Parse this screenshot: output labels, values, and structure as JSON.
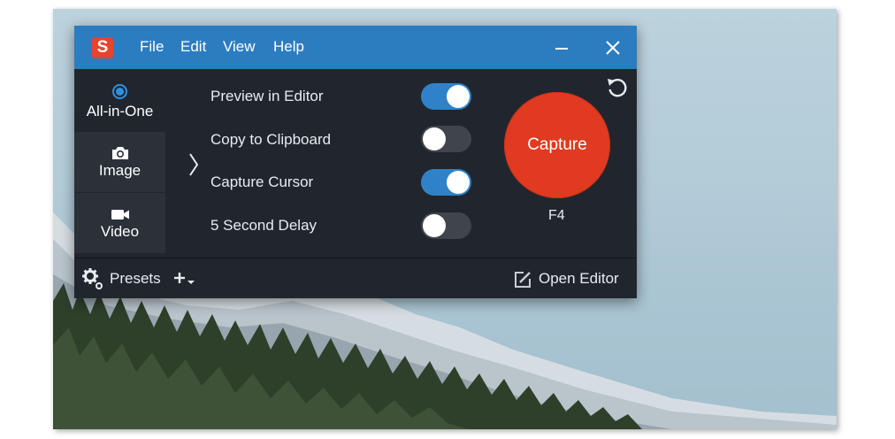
{
  "menu": {
    "file": "File",
    "edit": "Edit",
    "view": "View",
    "help": "Help"
  },
  "app_logo": "S",
  "modes": {
    "all_in_one": "All-in-One",
    "image": "Image",
    "video": "Video"
  },
  "options": [
    {
      "label": "Preview in Editor",
      "enabled": true
    },
    {
      "label": "Copy to Clipboard",
      "enabled": false
    },
    {
      "label": "Capture Cursor",
      "enabled": true
    },
    {
      "label": "5 Second Delay",
      "enabled": false
    }
  ],
  "capture": {
    "label": "Capture",
    "hotkey": "F4"
  },
  "footer": {
    "presets": "Presets",
    "open_editor": "Open Editor"
  },
  "icons": {
    "reset": "reset-icon",
    "presets": "gear-icon",
    "add_preset": "plus-dropdown-icon",
    "open_editor": "edit-icon",
    "image_mode": "camera-icon",
    "video_mode": "video-camera-icon",
    "minimize": "minimize-icon",
    "close": "close-icon"
  },
  "colors": {
    "titlebar": "#2c7cc0",
    "window_bg": "#21262e",
    "toggle_on": "#2f82c8",
    "capture": "#e03a20"
  }
}
